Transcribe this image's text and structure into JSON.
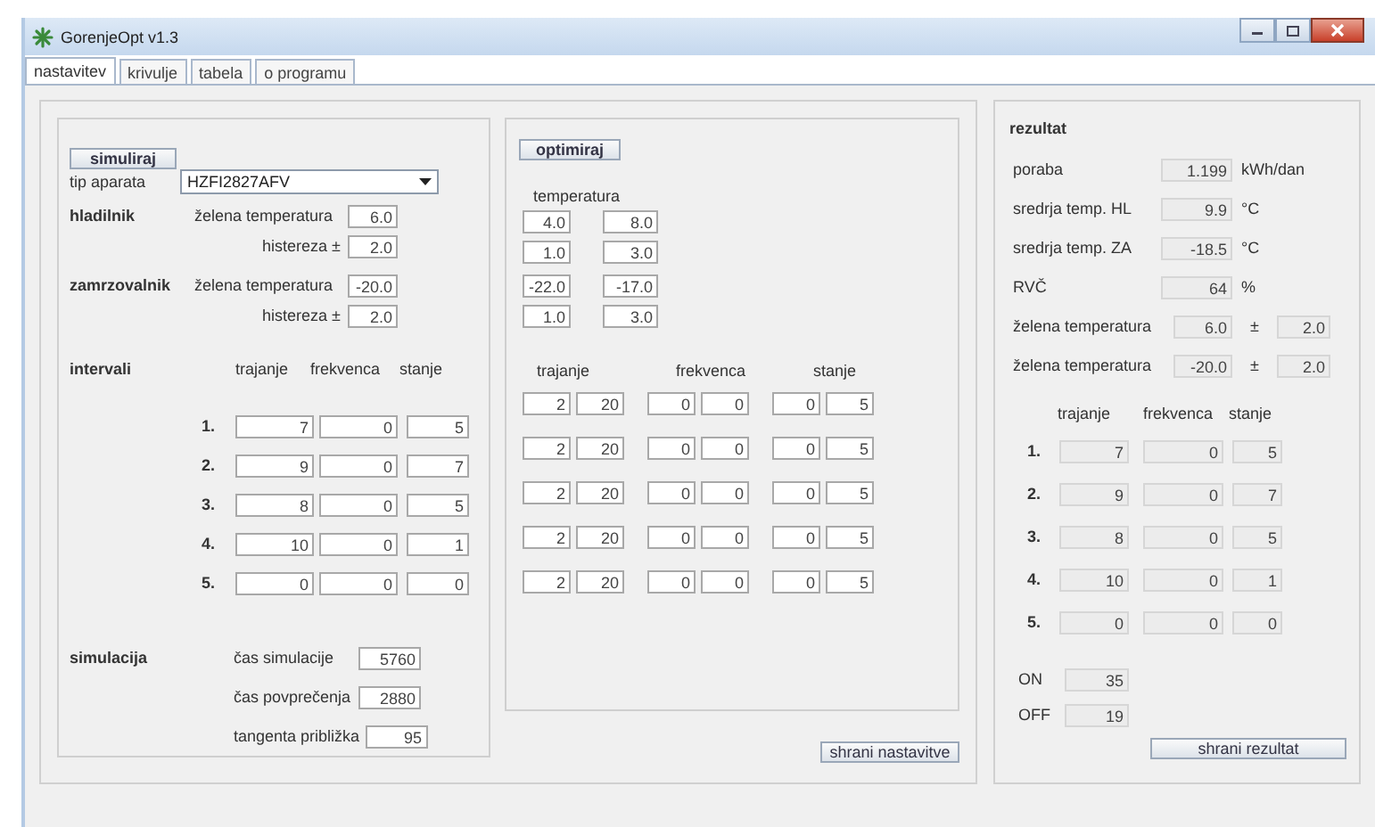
{
  "window": {
    "title": "GorenjeOpt v1.3"
  },
  "tabs": [
    {
      "label": "nastavitev",
      "selected": true
    },
    {
      "label": "krivulje",
      "selected": false
    },
    {
      "label": "tabela",
      "selected": false
    },
    {
      "label": "o programu",
      "selected": false
    }
  ],
  "settings": {
    "simulate_button": "simuliraj",
    "device_type": {
      "label": "tip aparata",
      "value": "HZFI2827AFV"
    },
    "compartments": [
      {
        "label": "hladilnik",
        "target_label": "želena temperatura",
        "target": "6.0",
        "hysteresis_label": "histereza ±",
        "hysteresis": "2.0"
      },
      {
        "label": "zamrzovalnik",
        "target_label": "želena temperatura",
        "target": "-20.0",
        "hysteresis_label": "histereza ±",
        "hysteresis": "2.0"
      }
    ],
    "intervals": {
      "label": "intervali",
      "columns": [
        "trajanje",
        "frekvenca",
        "stanje"
      ],
      "rows": [
        {
          "index": "1.",
          "values": [
            "7",
            "0",
            "5"
          ]
        },
        {
          "index": "2.",
          "values": [
            "9",
            "0",
            "7"
          ]
        },
        {
          "index": "3.",
          "values": [
            "8",
            "0",
            "5"
          ]
        },
        {
          "index": "4.",
          "values": [
            "10",
            "0",
            "1"
          ]
        },
        {
          "index": "5.",
          "values": [
            "0",
            "0",
            "0"
          ]
        }
      ]
    },
    "simulation": {
      "label": "simulacija",
      "fields": [
        {
          "label": "čas simulacije",
          "value": "5760"
        },
        {
          "label": "čas povprečenja",
          "value": "2880"
        },
        {
          "label": "tangenta približka",
          "value": "95"
        }
      ]
    }
  },
  "optimization": {
    "button": "optimiraj",
    "temperature_label": "temperatura",
    "temperature_rows": [
      [
        "4.0",
        "8.0"
      ],
      [
        "1.0",
        "3.0"
      ],
      [
        "-22.0",
        "-17.0"
      ],
      [
        "1.0",
        "3.0"
      ]
    ],
    "columns": [
      "trajanje",
      "frekvenca",
      "stanje"
    ],
    "rows": [
      [
        [
          "2",
          "20"
        ],
        [
          "0",
          "0"
        ],
        [
          "0",
          "5"
        ]
      ],
      [
        [
          "2",
          "20"
        ],
        [
          "0",
          "0"
        ],
        [
          "0",
          "5"
        ]
      ],
      [
        [
          "2",
          "20"
        ],
        [
          "0",
          "0"
        ],
        [
          "0",
          "5"
        ]
      ],
      [
        [
          "2",
          "20"
        ],
        [
          "0",
          "0"
        ],
        [
          "0",
          "5"
        ]
      ],
      [
        [
          "2",
          "20"
        ],
        [
          "0",
          "0"
        ],
        [
          "0",
          "5"
        ]
      ]
    ]
  },
  "save_settings_button": "shrani nastavitve",
  "result": {
    "title": "rezultat",
    "metrics": [
      {
        "label": "poraba",
        "value": "1.199",
        "unit": "kWh/dan"
      },
      {
        "label": "sredrja temp. HL",
        "value": "9.9",
        "unit": "°C"
      },
      {
        "label": "sredrja temp. ZA",
        "value": "-18.5",
        "unit": "°C"
      },
      {
        "label": "RVČ",
        "value": "64",
        "unit": "%"
      }
    ],
    "targets": [
      {
        "label": "želena temperatura",
        "value": "6.0",
        "sign": "±",
        "hysteresis": "2.0"
      },
      {
        "label": "želena temperatura",
        "value": "-20.0",
        "sign": "±",
        "hysteresis": "2.0"
      }
    ],
    "columns": [
      "trajanje",
      "frekvenca",
      "stanje"
    ],
    "rows": [
      {
        "index": "1.",
        "values": [
          "7",
          "0",
          "5"
        ]
      },
      {
        "index": "2.",
        "values": [
          "9",
          "0",
          "7"
        ]
      },
      {
        "index": "3.",
        "values": [
          "8",
          "0",
          "5"
        ]
      },
      {
        "index": "4.",
        "values": [
          "10",
          "0",
          "1"
        ]
      },
      {
        "index": "5.",
        "values": [
          "0",
          "0",
          "0"
        ]
      }
    ],
    "on_off": [
      {
        "label": "ON",
        "value": "35"
      },
      {
        "label": "OFF",
        "value": "19"
      }
    ],
    "save_button": "shrani rezultat"
  }
}
